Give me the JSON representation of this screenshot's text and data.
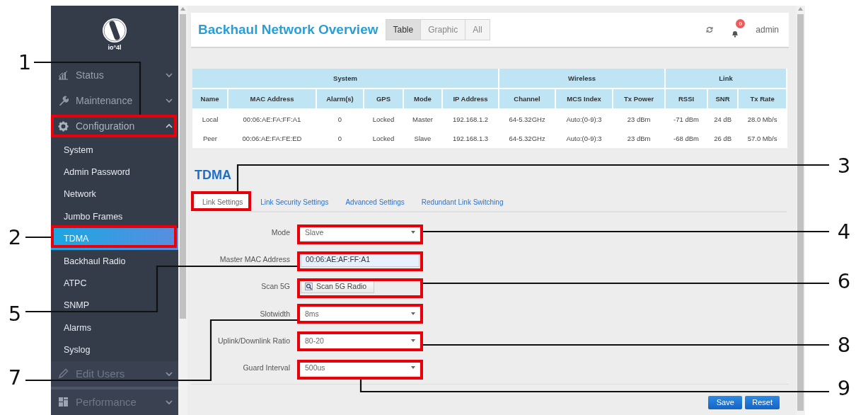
{
  "sidebar": {
    "logo_text": "io°4l",
    "menu": [
      {
        "label": "Status",
        "expanded": false
      },
      {
        "label": "Maintenance",
        "expanded": false
      },
      {
        "label": "Configuration",
        "expanded": true,
        "children": [
          {
            "label": "System",
            "selected": false
          },
          {
            "label": "Admin Password",
            "selected": false
          },
          {
            "label": "Network",
            "selected": false
          },
          {
            "label": "Jumbo Frames",
            "selected": false
          },
          {
            "label": "TDMA",
            "selected": true
          },
          {
            "label": "Backhaul Radio",
            "selected": false
          },
          {
            "label": "ATPC",
            "selected": false
          },
          {
            "label": "SNMP",
            "selected": false
          },
          {
            "label": "Alarms",
            "selected": false
          },
          {
            "label": "Syslog",
            "selected": false
          }
        ]
      },
      {
        "label": "Edit Users",
        "expanded": false
      },
      {
        "label": "Performance",
        "expanded": false
      }
    ]
  },
  "header": {
    "title": "Backhaul Network Overview",
    "view_tabs": [
      {
        "label": "Table",
        "selected": true
      },
      {
        "label": "Graphic",
        "selected": false
      },
      {
        "label": "All",
        "selected": false
      }
    ],
    "notification_count": "0",
    "user": "admin"
  },
  "table": {
    "groups": [
      {
        "label": "System",
        "columns": [
          "Name",
          "MAC Address",
          "Alarm(s)",
          "GPS",
          "Mode",
          "IP Address"
        ]
      },
      {
        "label": "Wireless",
        "columns": [
          "Channel",
          "MCS Index",
          "Tx Power"
        ]
      },
      {
        "label": "Link",
        "columns": [
          "RSSI",
          "SNR",
          "Tx Rate"
        ]
      }
    ],
    "rows": [
      [
        "Local",
        "00:06:AE:FA:FF:A1",
        "0",
        "Locked",
        "Master",
        "192.168.1.2",
        "64-5.32GHz",
        "Auto:(0-9):3",
        "23 dBm",
        "-71 dBm",
        "24 dB",
        "28.0 Mb/s"
      ],
      [
        "Peer",
        "00:06:AE:FA:FE:ED",
        "0",
        "Locked",
        "Slave",
        "192.168.1.3",
        "64-5.32GHz",
        "Auto:(0-9):3",
        "23 dBm",
        "-68 dBm",
        "26 dB",
        "57.0 Mb/s"
      ]
    ]
  },
  "tdma": {
    "title": "TDMA",
    "tabs": [
      {
        "label": "Link Settings",
        "selected": true
      },
      {
        "label": "Link Security Settings",
        "selected": false
      },
      {
        "label": "Advanced Settings",
        "selected": false
      },
      {
        "label": "Redundant Link Switching",
        "selected": false
      }
    ],
    "fields": [
      {
        "label": "Mode",
        "kind": "select",
        "value": "Slave"
      },
      {
        "label": "Master MAC Address",
        "kind": "input",
        "value": "00:06:AE:AF:FF:A1"
      },
      {
        "label": "Scan 5G",
        "kind": "button",
        "value": "Scan 5G Radio"
      },
      {
        "label": "Slotwidth",
        "kind": "select",
        "value": "8ms"
      },
      {
        "label": "Uplink/Downlink Ratio",
        "kind": "select",
        "value": "80-20"
      },
      {
        "label": "Guard Interval",
        "kind": "select",
        "value": "500us"
      }
    ],
    "buttons": [
      "Save",
      "Reset"
    ]
  },
  "callouts": [
    "1",
    "3",
    "2",
    "4",
    "6",
    "5",
    "8",
    "7",
    "9"
  ]
}
